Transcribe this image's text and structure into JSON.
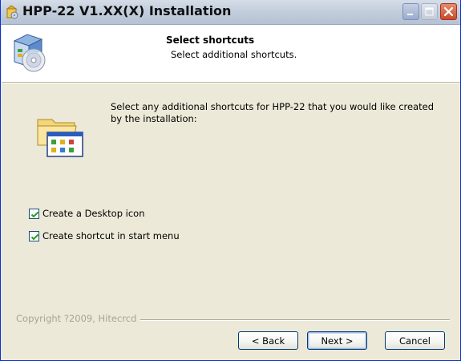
{
  "window": {
    "title": "HPP-22 V1.XX(X) Installation"
  },
  "header": {
    "title": "Select shortcuts",
    "subtitle": "Select additional shortcuts.",
    "icon": "setup-cd-icon"
  },
  "main": {
    "icon": "program-folder-icon",
    "instruction": "Select any additional shortcuts for HPP-22 that you would like created by the installation:",
    "options": [
      {
        "label": "Create a Desktop icon",
        "checked": true
      },
      {
        "label": "Create shortcut in start menu",
        "checked": true
      }
    ]
  },
  "footer": {
    "copyright": "Copyright ?2009, Hitecrcd",
    "back_label": "< Back",
    "next_label": "Next >",
    "cancel_label": "Cancel"
  },
  "colors": {
    "titlebar": "#c3cedd",
    "dialog_bg": "#ece9d8",
    "close_button": "#c84a2b",
    "checkbox_check": "#21a121"
  }
}
